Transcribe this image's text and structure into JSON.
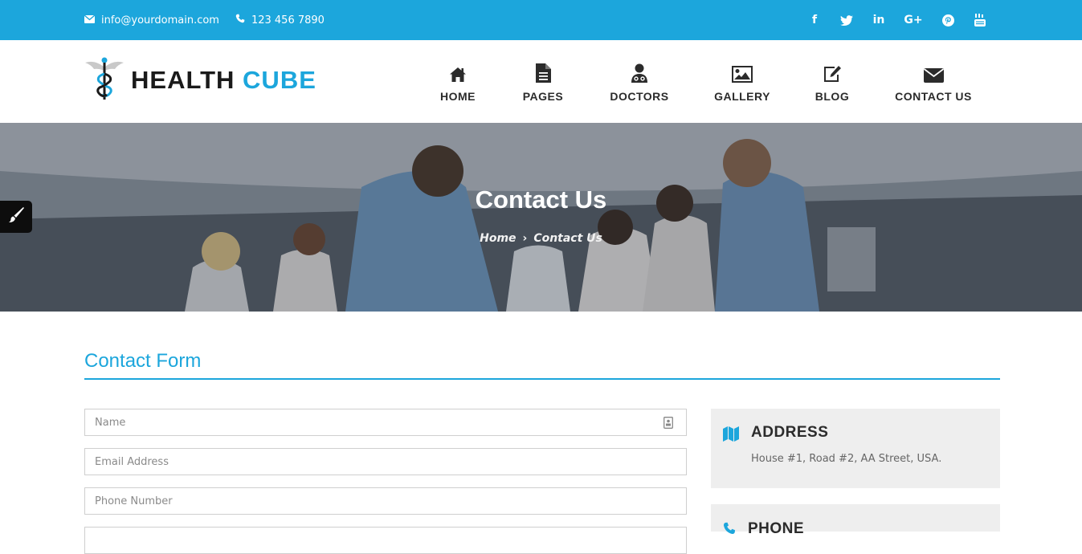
{
  "topbar": {
    "email": "info@yourdomain.com",
    "phone": "123 456 7890",
    "social": [
      "facebook-icon",
      "twitter-icon",
      "linkedin-icon",
      "google-plus-icon",
      "pinterest-icon",
      "youtube-icon"
    ],
    "background": "#1ca6dc"
  },
  "logo": {
    "word1": "HEALTH",
    "word2": "CUBE"
  },
  "nav": {
    "items": [
      {
        "label": "HOME",
        "icon": "home-icon"
      },
      {
        "label": "PAGES",
        "icon": "document-icon"
      },
      {
        "label": "DOCTORS",
        "icon": "doctor-icon"
      },
      {
        "label": "GALLERY",
        "icon": "image-icon"
      },
      {
        "label": "BLOG",
        "icon": "edit-icon"
      },
      {
        "label": "CONTACT US",
        "icon": "envelope-icon"
      }
    ]
  },
  "hero": {
    "title": "Contact Us",
    "breadcrumb": {
      "home": "Home",
      "separator": "›",
      "current": "Contact Us"
    }
  },
  "form": {
    "title": "Contact Form",
    "name_placeholder": "Name",
    "email_placeholder": "Email Address",
    "phone_placeholder": "Phone Number"
  },
  "info": {
    "address": {
      "heading": "ADDRESS",
      "text": "House #1, Road #2, AA Street, USA.",
      "icon": "map-icon"
    },
    "phone": {
      "heading": "PHONE",
      "icon": "phone-icon"
    }
  },
  "colors": {
    "accent": "#1ca6dc",
    "text_dark": "#2b2b2b",
    "panel": "#eeeeee"
  }
}
